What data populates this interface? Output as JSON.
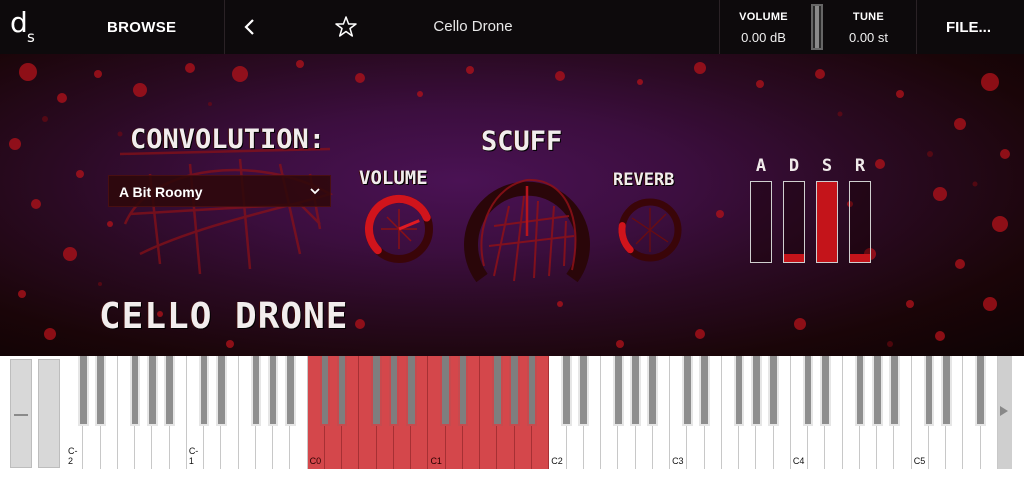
{
  "topbar": {
    "logo_main": "d",
    "logo_sub": "s",
    "browse_label": "BROWSE",
    "preset_name": "Cello Drone",
    "volume": {
      "label": "VOLUME",
      "value": "0.00 dB"
    },
    "tune": {
      "label": "TUNE",
      "value": "0.00 st"
    },
    "file_label": "FILE...",
    "icons": {
      "back": "chevron-left-icon",
      "favorite": "star-icon"
    }
  },
  "panel": {
    "convolution_title": "CONVOLUTION:",
    "convolution_selected": "A Bit Roomy",
    "scuff_title": "SCUFF",
    "volume_title": "VOLUME",
    "reverb_title": "REVERB",
    "instrument_title": "CELLO DRONE",
    "adsr": [
      {
        "letter": "A",
        "level": 0.0
      },
      {
        "letter": "D",
        "level": 0.1
      },
      {
        "letter": "S",
        "level": 1.0
      },
      {
        "letter": "R",
        "level": 0.1
      }
    ],
    "knobs": {
      "volume": 0.75,
      "scuff": 0.8,
      "reverb": 0.2
    },
    "colors": {
      "accent": "#c4141a",
      "background": "#3c0e3f"
    }
  },
  "keyboard": {
    "octave_labels": [
      "C-2",
      "C-1",
      "C0",
      "C1",
      "C2",
      "C3",
      "C4",
      "C5"
    ],
    "highlighted_range": "C0–B1",
    "highlight_color": "#d4474b"
  }
}
